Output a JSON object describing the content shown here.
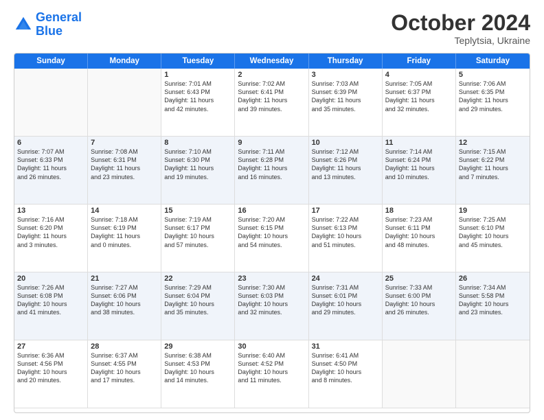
{
  "logo": {
    "line1": "General",
    "line2": "Blue"
  },
  "title": "October 2024",
  "location": "Teplytsia, Ukraine",
  "header_days": [
    "Sunday",
    "Monday",
    "Tuesday",
    "Wednesday",
    "Thursday",
    "Friday",
    "Saturday"
  ],
  "weeks": [
    [
      {
        "day": "",
        "lines": [],
        "empty": true
      },
      {
        "day": "",
        "lines": [],
        "empty": true
      },
      {
        "day": "1",
        "lines": [
          "Sunrise: 7:01 AM",
          "Sunset: 6:43 PM",
          "Daylight: 11 hours",
          "and 42 minutes."
        ]
      },
      {
        "day": "2",
        "lines": [
          "Sunrise: 7:02 AM",
          "Sunset: 6:41 PM",
          "Daylight: 11 hours",
          "and 39 minutes."
        ]
      },
      {
        "day": "3",
        "lines": [
          "Sunrise: 7:03 AM",
          "Sunset: 6:39 PM",
          "Daylight: 11 hours",
          "and 35 minutes."
        ]
      },
      {
        "day": "4",
        "lines": [
          "Sunrise: 7:05 AM",
          "Sunset: 6:37 PM",
          "Daylight: 11 hours",
          "and 32 minutes."
        ]
      },
      {
        "day": "5",
        "lines": [
          "Sunrise: 7:06 AM",
          "Sunset: 6:35 PM",
          "Daylight: 11 hours",
          "and 29 minutes."
        ]
      }
    ],
    [
      {
        "day": "6",
        "lines": [
          "Sunrise: 7:07 AM",
          "Sunset: 6:33 PM",
          "Daylight: 11 hours",
          "and 26 minutes."
        ],
        "shaded": true
      },
      {
        "day": "7",
        "lines": [
          "Sunrise: 7:08 AM",
          "Sunset: 6:31 PM",
          "Daylight: 11 hours",
          "and 23 minutes."
        ],
        "shaded": true
      },
      {
        "day": "8",
        "lines": [
          "Sunrise: 7:10 AM",
          "Sunset: 6:30 PM",
          "Daylight: 11 hours",
          "and 19 minutes."
        ],
        "shaded": true
      },
      {
        "day": "9",
        "lines": [
          "Sunrise: 7:11 AM",
          "Sunset: 6:28 PM",
          "Daylight: 11 hours",
          "and 16 minutes."
        ],
        "shaded": true
      },
      {
        "day": "10",
        "lines": [
          "Sunrise: 7:12 AM",
          "Sunset: 6:26 PM",
          "Daylight: 11 hours",
          "and 13 minutes."
        ],
        "shaded": true
      },
      {
        "day": "11",
        "lines": [
          "Sunrise: 7:14 AM",
          "Sunset: 6:24 PM",
          "Daylight: 11 hours",
          "and 10 minutes."
        ],
        "shaded": true
      },
      {
        "day": "12",
        "lines": [
          "Sunrise: 7:15 AM",
          "Sunset: 6:22 PM",
          "Daylight: 11 hours",
          "and 7 minutes."
        ],
        "shaded": true
      }
    ],
    [
      {
        "day": "13",
        "lines": [
          "Sunrise: 7:16 AM",
          "Sunset: 6:20 PM",
          "Daylight: 11 hours",
          "and 3 minutes."
        ]
      },
      {
        "day": "14",
        "lines": [
          "Sunrise: 7:18 AM",
          "Sunset: 6:19 PM",
          "Daylight: 11 hours",
          "and 0 minutes."
        ]
      },
      {
        "day": "15",
        "lines": [
          "Sunrise: 7:19 AM",
          "Sunset: 6:17 PM",
          "Daylight: 10 hours",
          "and 57 minutes."
        ]
      },
      {
        "day": "16",
        "lines": [
          "Sunrise: 7:20 AM",
          "Sunset: 6:15 PM",
          "Daylight: 10 hours",
          "and 54 minutes."
        ]
      },
      {
        "day": "17",
        "lines": [
          "Sunrise: 7:22 AM",
          "Sunset: 6:13 PM",
          "Daylight: 10 hours",
          "and 51 minutes."
        ]
      },
      {
        "day": "18",
        "lines": [
          "Sunrise: 7:23 AM",
          "Sunset: 6:11 PM",
          "Daylight: 10 hours",
          "and 48 minutes."
        ]
      },
      {
        "day": "19",
        "lines": [
          "Sunrise: 7:25 AM",
          "Sunset: 6:10 PM",
          "Daylight: 10 hours",
          "and 45 minutes."
        ]
      }
    ],
    [
      {
        "day": "20",
        "lines": [
          "Sunrise: 7:26 AM",
          "Sunset: 6:08 PM",
          "Daylight: 10 hours",
          "and 41 minutes."
        ],
        "shaded": true
      },
      {
        "day": "21",
        "lines": [
          "Sunrise: 7:27 AM",
          "Sunset: 6:06 PM",
          "Daylight: 10 hours",
          "and 38 minutes."
        ],
        "shaded": true
      },
      {
        "day": "22",
        "lines": [
          "Sunrise: 7:29 AM",
          "Sunset: 6:04 PM",
          "Daylight: 10 hours",
          "and 35 minutes."
        ],
        "shaded": true
      },
      {
        "day": "23",
        "lines": [
          "Sunrise: 7:30 AM",
          "Sunset: 6:03 PM",
          "Daylight: 10 hours",
          "and 32 minutes."
        ],
        "shaded": true
      },
      {
        "day": "24",
        "lines": [
          "Sunrise: 7:31 AM",
          "Sunset: 6:01 PM",
          "Daylight: 10 hours",
          "and 29 minutes."
        ],
        "shaded": true
      },
      {
        "day": "25",
        "lines": [
          "Sunrise: 7:33 AM",
          "Sunset: 6:00 PM",
          "Daylight: 10 hours",
          "and 26 minutes."
        ],
        "shaded": true
      },
      {
        "day": "26",
        "lines": [
          "Sunrise: 7:34 AM",
          "Sunset: 5:58 PM",
          "Daylight: 10 hours",
          "and 23 minutes."
        ],
        "shaded": true
      }
    ],
    [
      {
        "day": "27",
        "lines": [
          "Sunrise: 6:36 AM",
          "Sunset: 4:56 PM",
          "Daylight: 10 hours",
          "and 20 minutes."
        ]
      },
      {
        "day": "28",
        "lines": [
          "Sunrise: 6:37 AM",
          "Sunset: 4:55 PM",
          "Daylight: 10 hours",
          "and 17 minutes."
        ]
      },
      {
        "day": "29",
        "lines": [
          "Sunrise: 6:38 AM",
          "Sunset: 4:53 PM",
          "Daylight: 10 hours",
          "and 14 minutes."
        ]
      },
      {
        "day": "30",
        "lines": [
          "Sunrise: 6:40 AM",
          "Sunset: 4:52 PM",
          "Daylight: 10 hours",
          "and 11 minutes."
        ]
      },
      {
        "day": "31",
        "lines": [
          "Sunrise: 6:41 AM",
          "Sunset: 4:50 PM",
          "Daylight: 10 hours",
          "and 8 minutes."
        ]
      },
      {
        "day": "",
        "lines": [],
        "empty": true
      },
      {
        "day": "",
        "lines": [],
        "empty": true
      }
    ]
  ]
}
